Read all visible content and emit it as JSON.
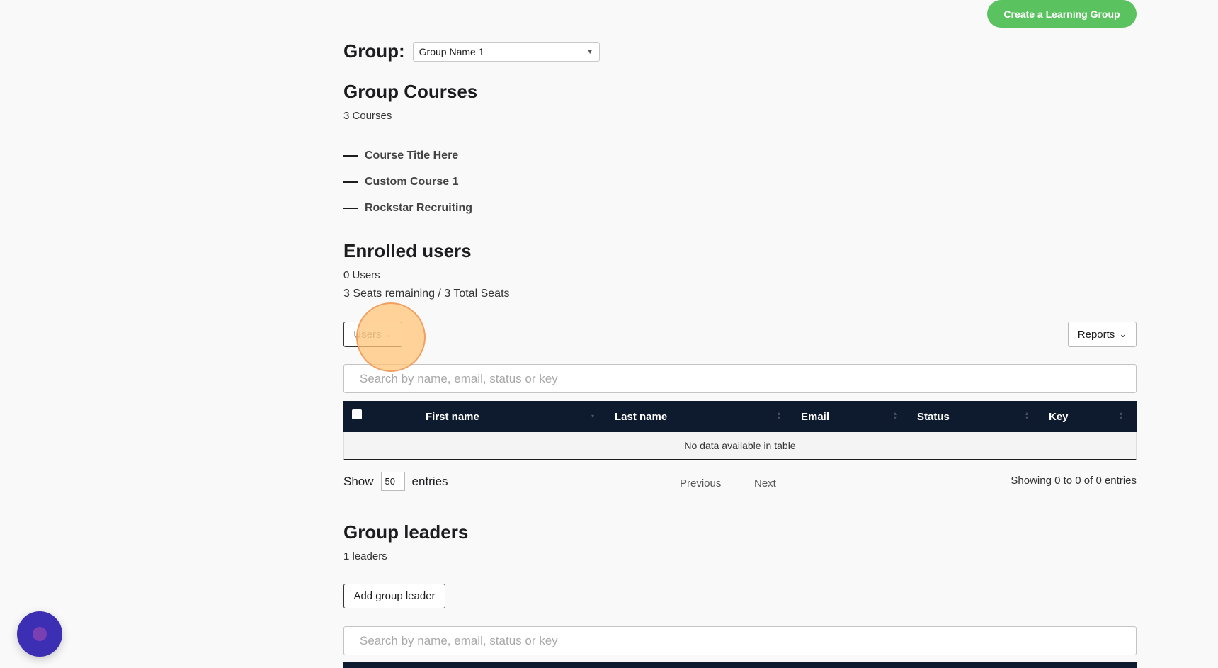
{
  "header": {
    "create_button": "Create a Learning Group"
  },
  "group": {
    "label": "Group:",
    "selected": "Group Name 1"
  },
  "courses": {
    "title": "Group Courses",
    "count_text": "3 Courses",
    "items": [
      "Course Title Here",
      "Custom Course 1",
      "Rockstar Recruiting"
    ]
  },
  "enrolled": {
    "title": "Enrolled users",
    "count_text": "0 Users",
    "seats_text": "3 Seats remaining / 3 Total Seats",
    "users_dropdown": "Users",
    "reports_dropdown": "Reports",
    "search_placeholder": "Search by name, email, status or key",
    "columns": [
      "First name",
      "Last name",
      "Email",
      "Status",
      "Key"
    ],
    "empty_text": "No data available in table",
    "show_label": "Show",
    "page_size": "50",
    "entries_label": "entries",
    "previous": "Previous",
    "next": "Next",
    "showing_text": "Showing 0 to 0 of 0 entries"
  },
  "leaders": {
    "title": "Group leaders",
    "count_text": "1 leaders",
    "add_button": "Add group leader",
    "search_placeholder": "Search by name, email, status or key"
  },
  "colors": {
    "accent_green": "#5ac25f",
    "table_header": "#0e1a2e",
    "chat_button": "#3d2fb4"
  }
}
